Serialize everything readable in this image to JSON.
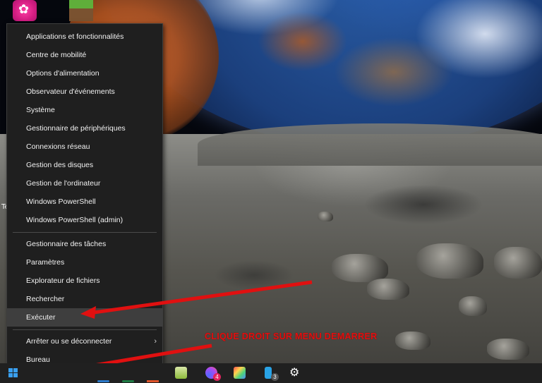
{
  "desktop": {
    "side_label": "Te",
    "icons": [
      "app-icon",
      "minecraft-icon"
    ]
  },
  "context_menu": {
    "items_group1": [
      "Applications et fonctionnalités",
      "Centre de mobilité",
      "Options d'alimentation",
      "Observateur d'événements",
      "Système",
      "Gestionnaire de périphériques",
      "Connexions réseau",
      "Gestion des disques",
      "Gestion de l'ordinateur",
      "Windows PowerShell",
      "Windows PowerShell (admin)"
    ],
    "items_group2": [
      "Gestionnaire des tâches",
      "Paramètres",
      "Explorateur de fichiers",
      "Rechercher",
      "Exécuter"
    ],
    "items_group3": [
      "Arrêter ou se déconnecter",
      "Bureau"
    ],
    "highlighted_item": "Exécuter",
    "submenu_arrow": "›"
  },
  "annotation": {
    "text": "CLIQUE DROIT SUR MENU DEMARRER",
    "color": "#e01010"
  },
  "taskbar": {
    "badges": {
      "messenger": "4",
      "files": "3"
    },
    "accent": "#3aa0f0"
  }
}
